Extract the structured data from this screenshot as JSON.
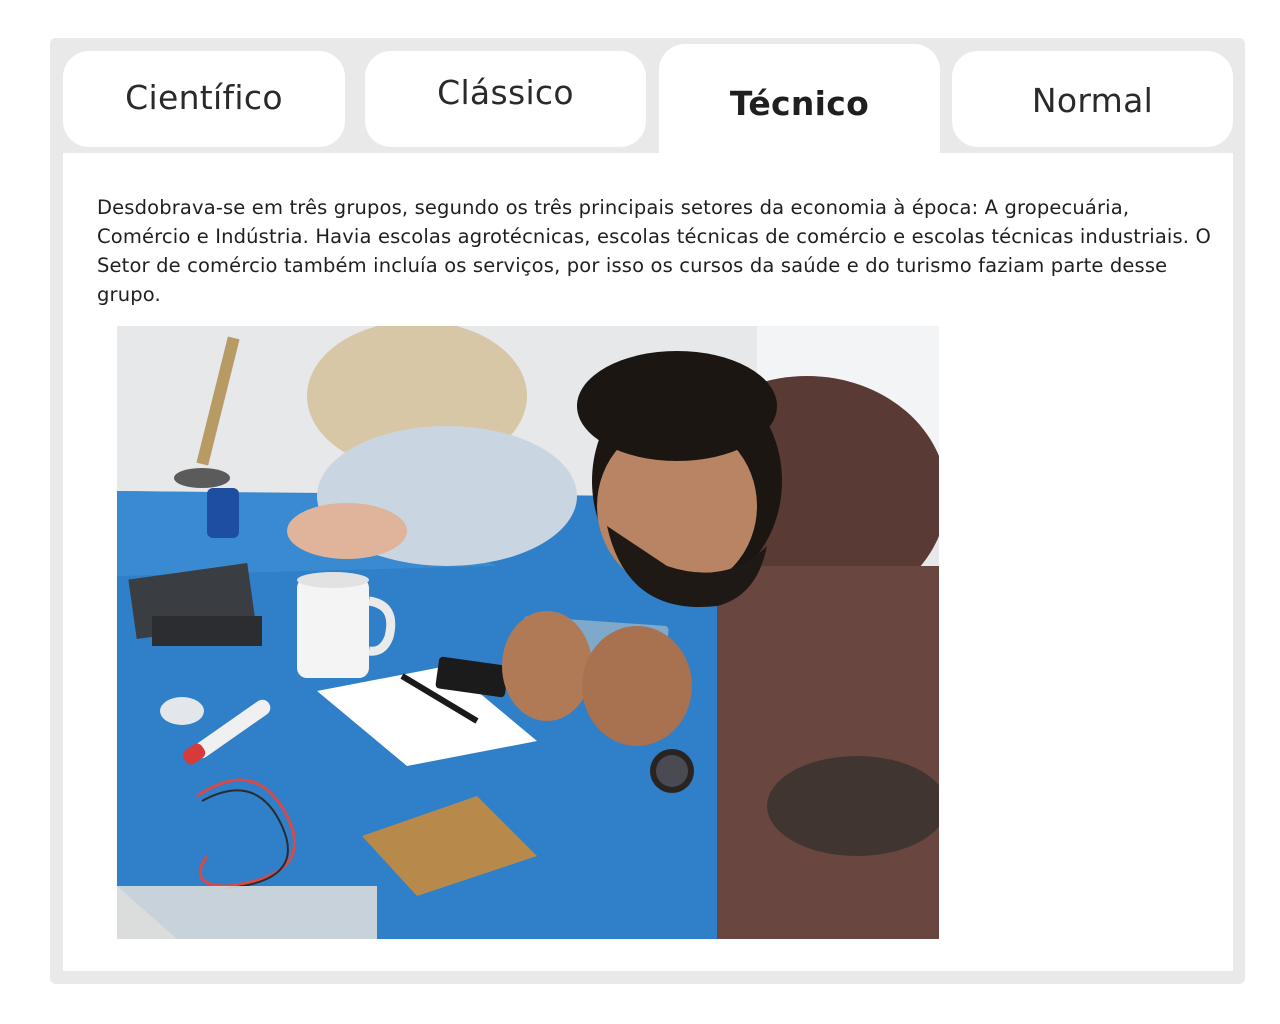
{
  "tabs": [
    {
      "label": "Científico",
      "active": false
    },
    {
      "label": "Clássico",
      "active": false
    },
    {
      "label": "Técnico",
      "active": true
    },
    {
      "label": "Normal",
      "active": false
    }
  ],
  "content": {
    "paragraph": "Desdobrava-se em três grupos, segundo os três principais setores da economia à época: A gropecuária, Comércio e Indústria. Havia escolas agrotécnicas, escolas técnicas de comércio e escolas técnicas industriais. O Setor de comércio também incluía os serviços, por isso os cursos da saúde e do turismo faziam parte desse grupo."
  },
  "colors": {
    "frame_background": "#e9e9e9",
    "panel_background": "#ffffff",
    "text": "#1f1f1f",
    "mat_blue": "#2f7fc9"
  }
}
